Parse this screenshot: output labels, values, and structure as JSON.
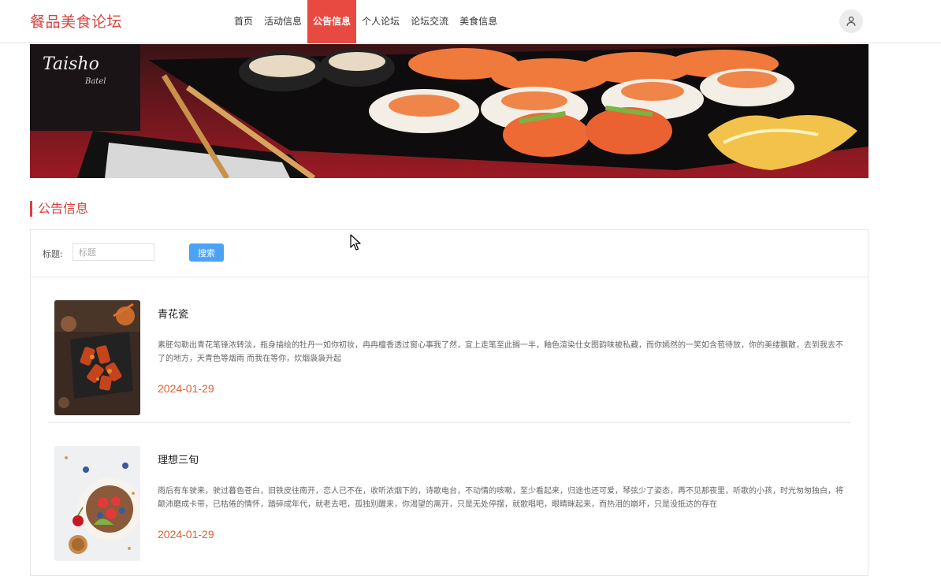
{
  "header": {
    "logo": "餐品美食论坛",
    "nav": [
      {
        "label": "首页"
      },
      {
        "label": "活动信息"
      },
      {
        "label": "公告信息",
        "active": true
      },
      {
        "label": "个人论坛"
      },
      {
        "label": "论坛交流"
      },
      {
        "label": "美食信息"
      }
    ],
    "avatar_icon": "user-icon"
  },
  "banner": {
    "brand_text": "Taisho",
    "brand_sub": "Batel"
  },
  "section": {
    "title": "公告信息"
  },
  "search": {
    "label": "标题:",
    "placeholder": "标题",
    "button": "搜索"
  },
  "items": [
    {
      "title": "青花瓷",
      "desc": "素胚勾勒出青花笔锋浓转淡，瓶身描绘的牡丹一如你初妆，冉冉檀香透过窗心事我了然，宣上走笔至此搁一半，釉色渲染仕女图韵味被私藏，而你嫣然的一笑如含苞待放，你的美缕飘散，去到我去不了的地方，天青色等烟雨 而我在等你，炊烟袅袅升起",
      "date": "2024-01-29"
    },
    {
      "title": "理想三旬",
      "desc": "雨后有车驶来，驶过暮色苍白，旧铁皮往南开，恋人已不在，收听浓烟下的，诗歌电台，不动情的咳嗽，至少看起来，归途也还可爱，琴弦少了姿态，再不见那夜里，听歌的小孩，时光匆匆独白，将颠沛磨成卡带，已枯倦的情怀，踏碎成年代，就老去吧，孤独别醒来，你渴望的离开，只是无处停摆，就歌唱吧，眼睛眯起来，而热泪的崩坏，只是没抵达的存在",
      "date": "2024-01-29"
    }
  ],
  "colors": {
    "brand": "#d8413f",
    "nav_active": "#e84a41",
    "button": "#4ba3f5",
    "date": "#e0602e"
  }
}
